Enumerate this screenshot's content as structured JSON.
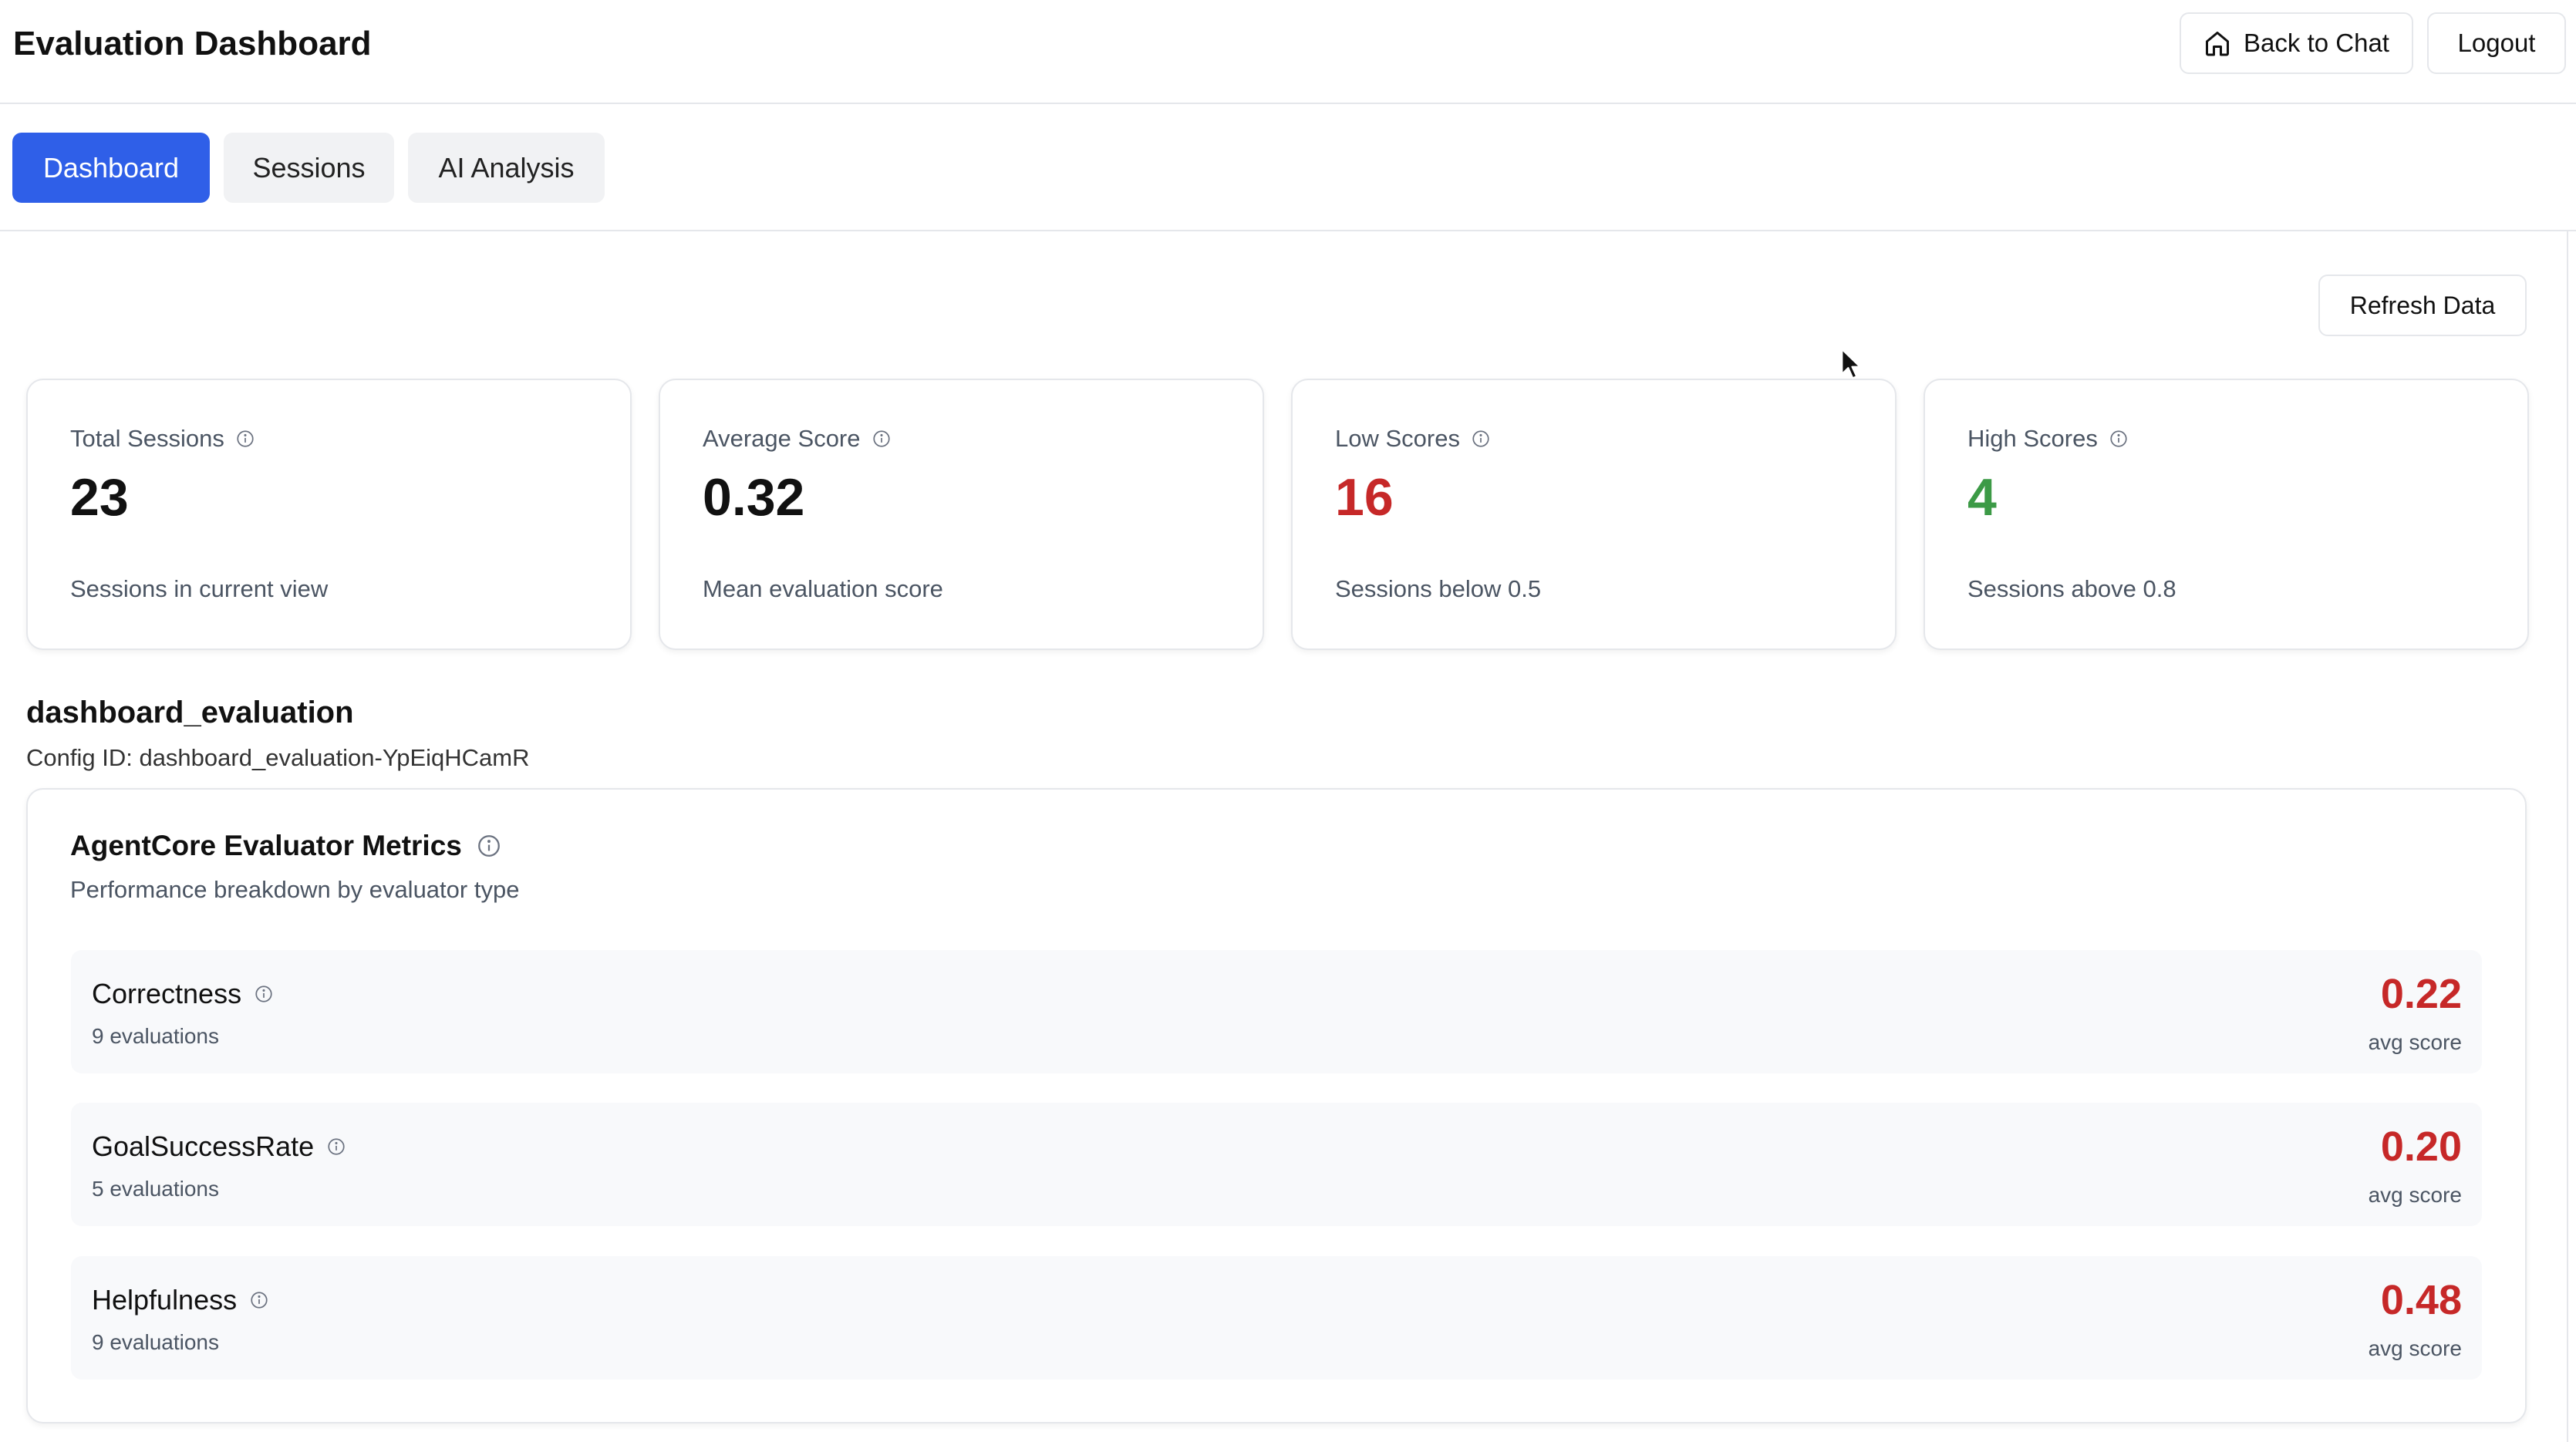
{
  "header": {
    "title": "Evaluation Dashboard",
    "back_to_chat_label": "Back to Chat",
    "logout_label": "Logout"
  },
  "tabs": [
    {
      "label": "Dashboard",
      "active": true
    },
    {
      "label": "Sessions",
      "active": false
    },
    {
      "label": "AI Analysis",
      "active": false
    }
  ],
  "refresh_label": "Refresh Data",
  "stats": [
    {
      "label": "Total Sessions",
      "value": "23",
      "sub": "Sessions in current view"
    },
    {
      "label": "Average Score",
      "value": "0.32",
      "sub": "Mean evaluation score"
    },
    {
      "label": "Low Scores",
      "value": "16",
      "sub": "Sessions below 0.5",
      "color": "#c62828"
    },
    {
      "label": "High Scores",
      "value": "4",
      "sub": "Sessions above 0.8",
      "color": "#3c9a46"
    }
  ],
  "config": {
    "name": "dashboard_evaluation",
    "id_text": "Config ID: dashboard_evaluation-YpEiqHCamR"
  },
  "metrics": {
    "title": "AgentCore Evaluator Metrics",
    "subtitle": "Performance breakdown by evaluator type",
    "rows": [
      {
        "name": "Correctness",
        "count": "9 evaluations",
        "score": "0.22",
        "score_label": "avg score"
      },
      {
        "name": "GoalSuccessRate",
        "count": "5 evaluations",
        "score": "0.20",
        "score_label": "avg score"
      },
      {
        "name": "Helpfulness",
        "count": "9 evaluations",
        "score": "0.48",
        "score_label": "avg score"
      }
    ]
  },
  "colors": {
    "accent": "#2f5fe8",
    "danger": "#c62828",
    "success": "#3c9a46"
  }
}
